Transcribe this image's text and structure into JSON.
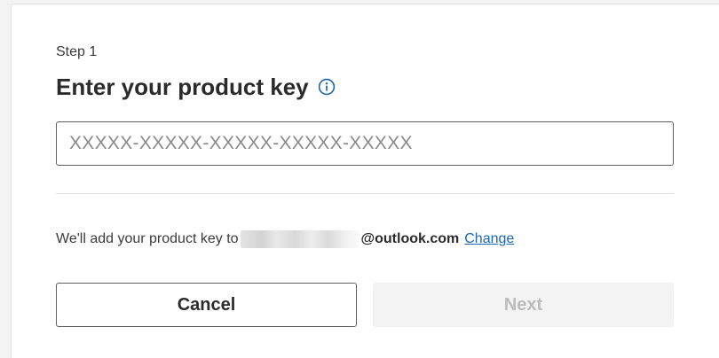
{
  "dialog": {
    "step_label": "Step 1",
    "title": "Enter your product key",
    "info_icon": "info-circle-icon",
    "product_key": {
      "value": "",
      "placeholder": "XXXXX-XXXXX-XXXXX-XXXXX-XXXXX"
    },
    "account": {
      "prefix_text": "We'll add your product key to",
      "email_suffix": "@outlook.com",
      "change_label": "Change"
    },
    "buttons": {
      "cancel_label": "Cancel",
      "next_label": "Next",
      "next_enabled": false
    }
  },
  "colors": {
    "link": "#1a66b0",
    "info_icon": "#1a66b0",
    "border": "#5f5f5f",
    "disabled_bg": "#f3f3f3",
    "disabled_text": "#bcbcbc"
  }
}
